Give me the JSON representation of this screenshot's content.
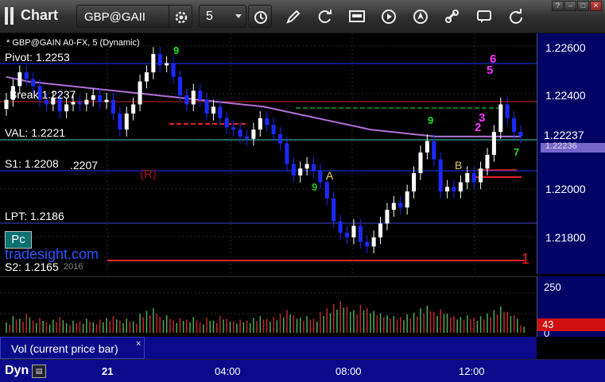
{
  "app": {
    "title": "Chart"
  },
  "toolbar": {
    "symbol": "GBP@GAII",
    "period": "5",
    "icons": [
      "gear-icon",
      "clock-icon",
      "pencil-icon",
      "refresh-icon",
      "get-icon",
      "play-icon",
      "compass-icon",
      "link-icon",
      "message-icon",
      "refresh-circle-icon"
    ]
  },
  "window": {
    "help": "?",
    "minimize": "–",
    "maximize": "□",
    "close": "✕"
  },
  "chart": {
    "header": "* GBP@GAIN A0-FX, 5 (Dynamic)",
    "levels": {
      "pivot": "Pivot: 1.2253",
      "break": "Break 1.2237",
      "val": "VAL: 1.2221",
      "s1": "S1: 1.2208",
      "s1_extra": ".2207",
      "lpt": "LPT: 1.2186",
      "s2": "S2: 1.2165"
    },
    "watermark": "tradesight.com",
    "watermark_sub": "2016",
    "pc_label": "Pc",
    "r_marker": "(R)",
    "marker_a": "A",
    "marker_b": "B",
    "marker_one": "1",
    "current_price": "1.22237",
    "current_price_sub": "1.22236",
    "volume_current": "43"
  },
  "chart_data": {
    "type": "candlestick",
    "title": "* GBP@GAIN A0-FX, 5 (Dynamic)",
    "ylim": [
      1.2162,
      1.2267
    ],
    "y_ticks": [
      "1.22600",
      "1.22400",
      "1.22237",
      "1.22000",
      "1.21800"
    ],
    "x_ticks": [
      "21",
      "04:00",
      "08:00",
      "12:00"
    ],
    "volume_ticks": [
      "250",
      "0"
    ],
    "volume_ylim": [
      0,
      300
    ],
    "close": [
      1.2238,
      1.2244,
      1.225,
      1.2247,
      1.2244,
      1.2238,
      1.2236,
      1.2239,
      1.2233,
      1.2236,
      1.2237,
      1.2236,
      1.2238,
      1.224,
      1.2237,
      1.2238,
      1.2232,
      1.2225,
      1.2232,
      1.2236,
      1.2246,
      1.225,
      1.2258,
      1.2253,
      1.2254,
      1.2248,
      1.224,
      1.2236,
      1.2242,
      1.2238,
      1.2232,
      1.2235,
      1.223,
      1.2226,
      1.2225,
      1.2222,
      1.2221,
      1.2225,
      1.223,
      1.2227,
      1.2223,
      1.2219,
      1.221,
      1.2205,
      1.2208,
      1.221,
      1.2207,
      1.2202,
      1.2195,
      1.2185,
      1.218,
      1.2178,
      1.2183,
      1.2176,
      1.2174,
      1.2178,
      1.2184,
      1.219,
      1.2193,
      1.2191,
      1.2198,
      1.2206,
      1.2215,
      1.222,
      1.2212,
      1.2198,
      1.22,
      1.2198,
      1.2202,
      1.2206,
      1.2202,
      1.2208,
      1.2214,
      1.2224,
      1.2236,
      1.223,
      1.2224,
      1.2222
    ],
    "volume": [
      60,
      95,
      80,
      110,
      70,
      85,
      60,
      75,
      90,
      55,
      70,
      65,
      80,
      60,
      75,
      85,
      95,
      70,
      80,
      65,
      110,
      125,
      140,
      90,
      100,
      70,
      85,
      75,
      90,
      60,
      85,
      70,
      95,
      80,
      65,
      75,
      70,
      85,
      95,
      80,
      90,
      110,
      130,
      100,
      85,
      95,
      80,
      120,
      140,
      165,
      180,
      150,
      130,
      160,
      140,
      125,
      110,
      100,
      95,
      90,
      105,
      115,
      140,
      155,
      120,
      135,
      110,
      95,
      90,
      100,
      85,
      95,
      110,
      130,
      150,
      120,
      100,
      43
    ],
    "overlay_ma": [
      1.2248,
      1.2246,
      1.2245,
      1.2244,
      1.2243,
      1.2242,
      1.2241,
      1.224,
      1.2239,
      1.2238,
      1.2237,
      1.2236,
      1.2235,
      1.2233,
      1.2231,
      1.2229,
      1.2227,
      1.2225,
      1.2224,
      1.2223,
      1.2222,
      1.2222,
      1.2222,
      1.2222,
      1.2222
    ]
  },
  "volume": {
    "legend": "Vol (current price bar)",
    "close_label": "×"
  },
  "status": {
    "dyn_label": "Dyn"
  },
  "colors": {
    "up_candle": "#ffffff",
    "down_candle": "#1a2aff",
    "ma_line": "#b070d8",
    "break_line": "#cc2222",
    "pivot_line": "#2233ff",
    "val_line": "#40d0d0",
    "dashed_green": "#10a030",
    "price_marker": "#7766cc",
    "volume_marker": "#d01010"
  }
}
